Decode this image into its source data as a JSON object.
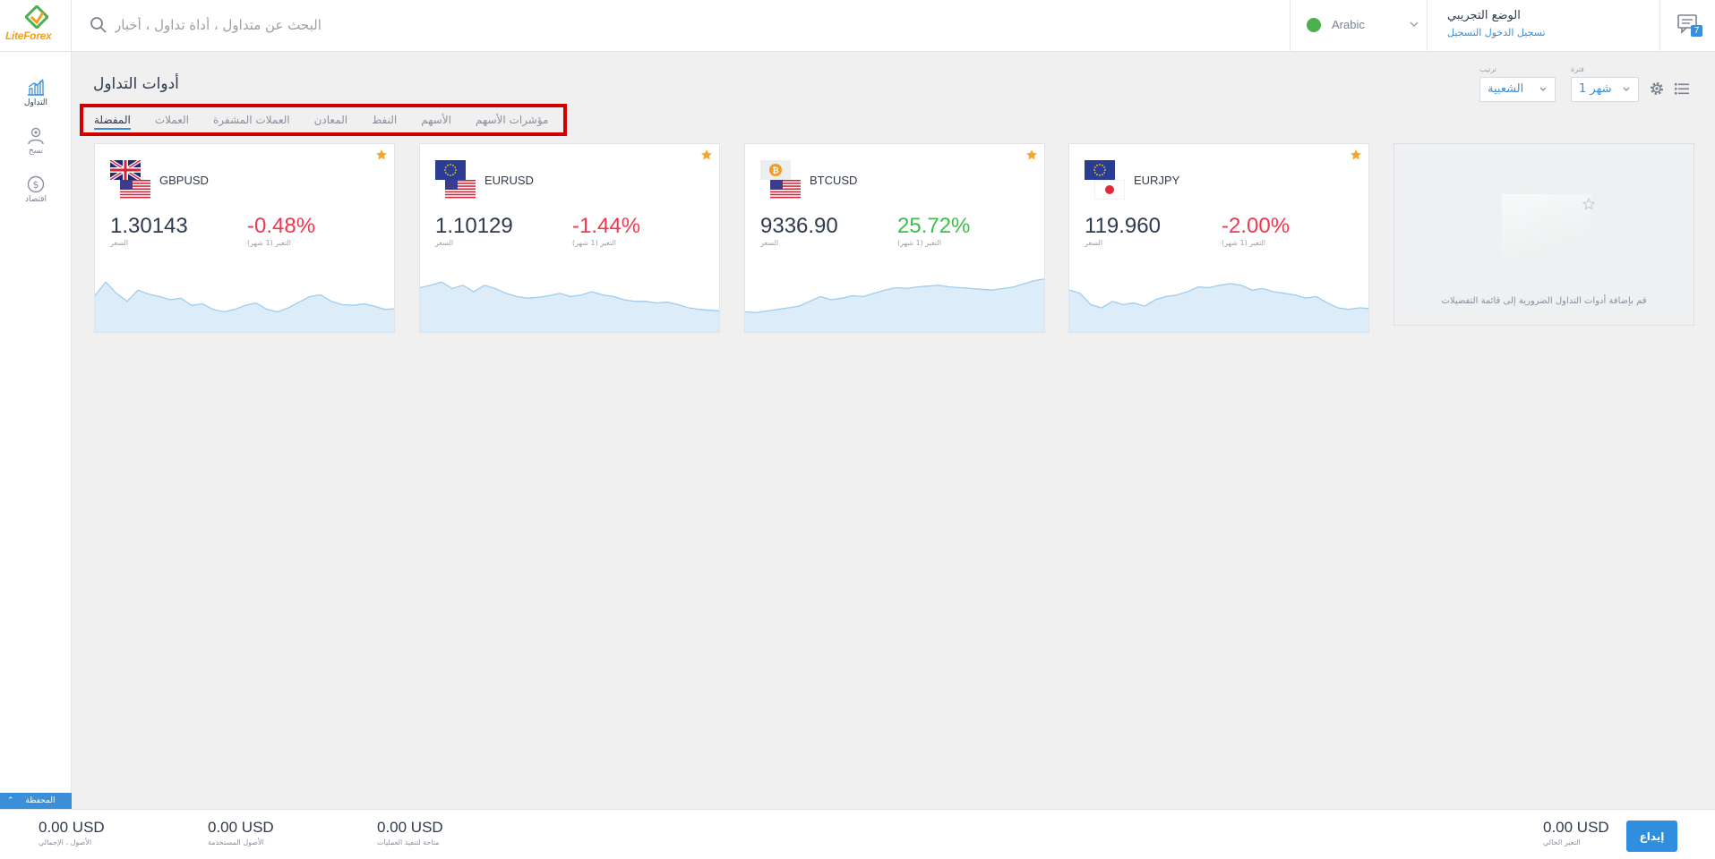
{
  "header": {
    "brand": "LiteForex",
    "search_placeholder": "البحث عن متداول ، أداة تداول ، أخبار",
    "language": "Arabic",
    "demo_mode_title": "الوضع التجريبي",
    "register_link": "تسجيل الدخول التسجيل",
    "notification_count": "7"
  },
  "sidebar": {
    "items": [
      {
        "label": "التداول",
        "icon": "trading-chart-icon",
        "active": true
      },
      {
        "label": "نسخ",
        "icon": "copy-user-icon",
        "active": false
      },
      {
        "label": "اقتصاد",
        "icon": "dollar-coin-icon",
        "active": false
      }
    ],
    "portfolio_tab": "المحفظة"
  },
  "main": {
    "title": "أدوات التداول",
    "tabs": [
      {
        "label": "المفضلة",
        "active": true
      },
      {
        "label": "العملات",
        "active": false
      },
      {
        "label": "العملات المشفرة",
        "active": false
      },
      {
        "label": "المعادن",
        "active": false
      },
      {
        "label": "النفط",
        "active": false
      },
      {
        "label": "الأسهم",
        "active": false
      },
      {
        "label": "مؤشرات الأسهم",
        "active": false
      }
    ],
    "sort_label": "ترتيب",
    "sort_value": "الشعبية",
    "period_label": "فترة",
    "period_value": "شهر 1"
  },
  "cards": [
    {
      "symbol": "GBPUSD",
      "price": "1.30143",
      "price_label": "السعر",
      "change": "-0.48%",
      "change_label": "التغير (1 شهر)",
      "direction": "neg",
      "flags": [
        "uk",
        "us"
      ],
      "spark": [
        45,
        62,
        48,
        38,
        52,
        47,
        44,
        40,
        42,
        33,
        35,
        28,
        25,
        28,
        33,
        36,
        28,
        25,
        30,
        37,
        44,
        46,
        38,
        34,
        33,
        35,
        32,
        28,
        29
      ]
    },
    {
      "symbol": "EURUSD",
      "price": "1.10129",
      "price_label": "السعر",
      "change": "-1.44%",
      "change_label": "التغير (1 شهر)",
      "direction": "neg",
      "flags": [
        "eu",
        "us"
      ],
      "spark": [
        55,
        58,
        62,
        54,
        58,
        50,
        58,
        54,
        48,
        44,
        42,
        43,
        45,
        48,
        44,
        46,
        50,
        46,
        44,
        40,
        38,
        38,
        36,
        37,
        34,
        30,
        28,
        27,
        26
      ]
    },
    {
      "symbol": "BTCUSD",
      "price": "9336.90",
      "price_label": "السعر",
      "change": "25.72%",
      "change_label": "التغير (1 شهر)",
      "direction": "pos",
      "flags": [
        "btc",
        "us"
      ],
      "spark": [
        25,
        24,
        26,
        28,
        30,
        32,
        38,
        44,
        40,
        42,
        45,
        44,
        48,
        52,
        55,
        54,
        56,
        57,
        58,
        56,
        55,
        54,
        53,
        52,
        54,
        56,
        60,
        64,
        66
      ]
    },
    {
      "symbol": "EURJPY",
      "price": "119.960",
      "price_label": "السعر",
      "change": "-2.00%",
      "change_label": "التغير (1 شهر)",
      "direction": "neg",
      "flags": [
        "eu",
        "jp"
      ],
      "spark": [
        52,
        48,
        34,
        30,
        38,
        34,
        36,
        32,
        40,
        44,
        46,
        50,
        56,
        55,
        58,
        60,
        58,
        52,
        54,
        50,
        48,
        46,
        42,
        44,
        36,
        30,
        28,
        30,
        29
      ]
    }
  ],
  "empty_card": {
    "text": "قم بإضافة أدوات التداول الضرورية إلى قائمة التفضيلات"
  },
  "footer": {
    "stats_left": [
      {
        "value": "0.00 USD",
        "label": "الأصول ، الإجمالي"
      },
      {
        "value": "0.00 USD",
        "label": "الأصول المستخدمة"
      },
      {
        "value": "0.00 USD",
        "label": "متاحة لتنفيذ العمليات"
      }
    ],
    "current_change": {
      "value": "0.00 USD",
      "label": "التغير الحالي"
    },
    "deposit_button": "إيداع"
  },
  "colors": {
    "accent": "#3b8fd8",
    "negative": "#f0384f",
    "positive": "#3dbf4a",
    "star": "#f5a623",
    "spark_fill": "#dcecf8",
    "spark_line": "#9fcdee",
    "highlight_box": "#d00000"
  }
}
